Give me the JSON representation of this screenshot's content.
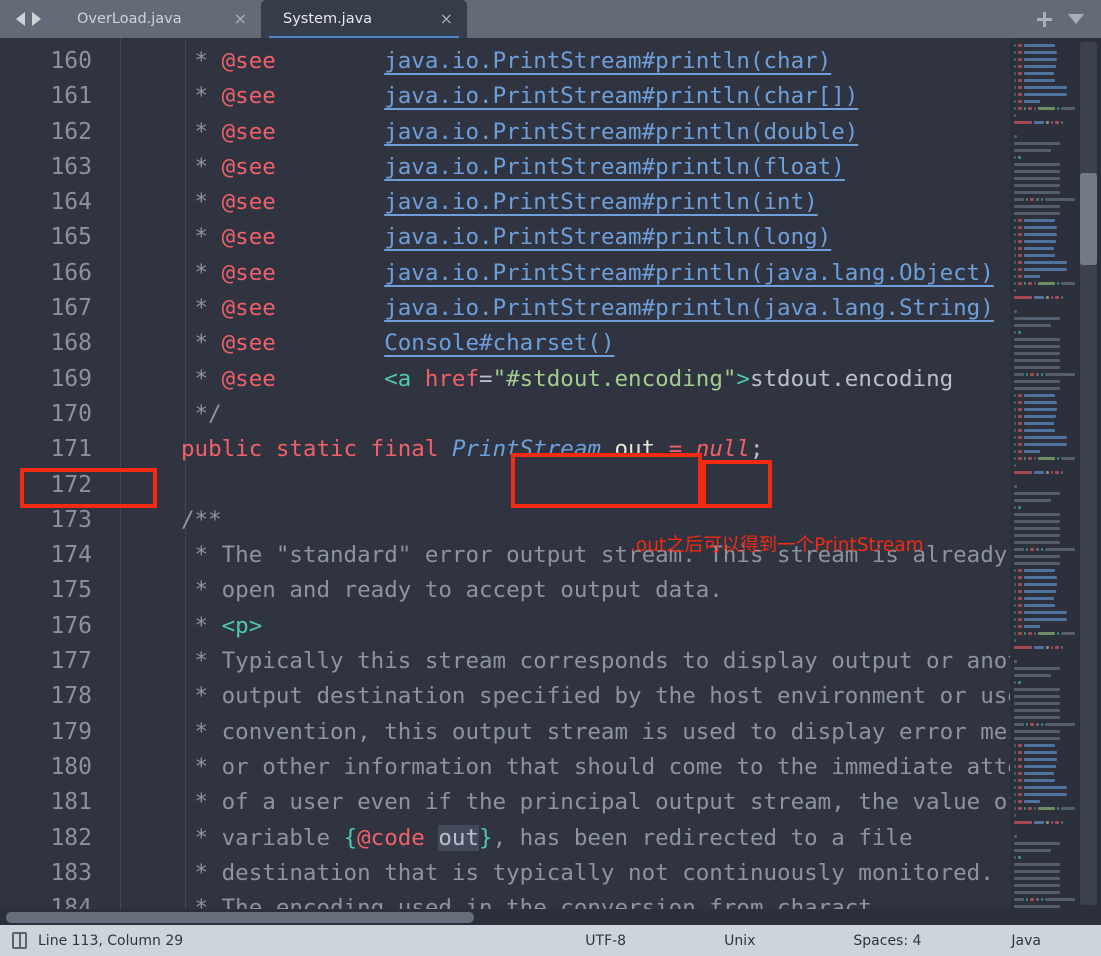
{
  "window": {
    "tabs": [
      {
        "label": "OverLoad.java",
        "active": false,
        "close": "×"
      },
      {
        "label": "System.java",
        "active": true,
        "close": "×"
      }
    ],
    "nav_back_icon": "arrow-left-icon",
    "nav_forward_icon": "arrow-right-icon",
    "new_tab_icon": "plus-icon",
    "tab_menu_icon": "chevron-down-icon"
  },
  "editor": {
    "first_line": 160,
    "line_numbers": [
      160,
      161,
      162,
      163,
      164,
      165,
      166,
      167,
      168,
      169,
      170,
      171,
      172,
      173,
      174,
      175,
      176,
      177,
      178,
      179,
      180,
      181,
      182,
      183,
      184
    ],
    "lines": [
      {
        "n": 160,
        "tokens": [
          {
            "t": " * ",
            "c": "cmt"
          },
          {
            "t": "@see",
            "c": "tag"
          },
          {
            "t": "        ",
            "c": "plain"
          },
          {
            "t": "java.io.PrintStream#println(char)",
            "c": "link"
          }
        ]
      },
      {
        "n": 161,
        "tokens": [
          {
            "t": " * ",
            "c": "cmt"
          },
          {
            "t": "@see",
            "c": "tag"
          },
          {
            "t": "        ",
            "c": "plain"
          },
          {
            "t": "java.io.PrintStream#println(char[])",
            "c": "link"
          }
        ]
      },
      {
        "n": 162,
        "tokens": [
          {
            "t": " * ",
            "c": "cmt"
          },
          {
            "t": "@see",
            "c": "tag"
          },
          {
            "t": "        ",
            "c": "plain"
          },
          {
            "t": "java.io.PrintStream#println(double)",
            "c": "link"
          }
        ]
      },
      {
        "n": 163,
        "tokens": [
          {
            "t": " * ",
            "c": "cmt"
          },
          {
            "t": "@see",
            "c": "tag"
          },
          {
            "t": "        ",
            "c": "plain"
          },
          {
            "t": "java.io.PrintStream#println(float)",
            "c": "link"
          }
        ]
      },
      {
        "n": 164,
        "tokens": [
          {
            "t": " * ",
            "c": "cmt"
          },
          {
            "t": "@see",
            "c": "tag"
          },
          {
            "t": "        ",
            "c": "plain"
          },
          {
            "t": "java.io.PrintStream#println(int)",
            "c": "link"
          }
        ]
      },
      {
        "n": 165,
        "tokens": [
          {
            "t": " * ",
            "c": "cmt"
          },
          {
            "t": "@see",
            "c": "tag"
          },
          {
            "t": "        ",
            "c": "plain"
          },
          {
            "t": "java.io.PrintStream#println(long)",
            "c": "link"
          }
        ]
      },
      {
        "n": 166,
        "tokens": [
          {
            "t": " * ",
            "c": "cmt"
          },
          {
            "t": "@see",
            "c": "tag"
          },
          {
            "t": "        ",
            "c": "plain"
          },
          {
            "t": "java.io.PrintStream#println(java.lang.Object)",
            "c": "link"
          }
        ]
      },
      {
        "n": 167,
        "tokens": [
          {
            "t": " * ",
            "c": "cmt"
          },
          {
            "t": "@see",
            "c": "tag"
          },
          {
            "t": "        ",
            "c": "plain"
          },
          {
            "t": "java.io.PrintStream#println(java.lang.String)",
            "c": "link"
          }
        ]
      },
      {
        "n": 168,
        "tokens": [
          {
            "t": " * ",
            "c": "cmt"
          },
          {
            "t": "@see",
            "c": "tag"
          },
          {
            "t": "        ",
            "c": "plain"
          },
          {
            "t": "Console#charset()",
            "c": "link"
          }
        ]
      },
      {
        "n": 169,
        "tokens": [
          {
            "t": " * ",
            "c": "cmt"
          },
          {
            "t": "@see",
            "c": "tag"
          },
          {
            "t": "        ",
            "c": "plain"
          },
          {
            "t": "<a",
            "c": "brk"
          },
          {
            "t": " ",
            "c": "plain"
          },
          {
            "t": "href",
            "c": "attr"
          },
          {
            "t": "=",
            "c": "plain"
          },
          {
            "t": "\"#stdout.encoding\"",
            "c": "str"
          },
          {
            "t": ">",
            "c": "brk"
          },
          {
            "t": "stdout.encoding",
            "c": "plain"
          }
        ]
      },
      {
        "n": 170,
        "tokens": [
          {
            "t": " */",
            "c": "cmt"
          }
        ]
      },
      {
        "n": 171,
        "tokens": [
          {
            "t": "public static final",
            "c": "kw"
          },
          {
            "t": " ",
            "c": "plain"
          },
          {
            "t": "PrintStream",
            "c": "type"
          },
          {
            "t": " ",
            "c": "plain"
          },
          {
            "t": "out",
            "c": "ident"
          },
          {
            "t": " ",
            "c": "plain"
          },
          {
            "t": "=",
            "c": "kw"
          },
          {
            "t": " ",
            "c": "plain"
          },
          {
            "t": "null",
            "c": "null"
          },
          {
            "t": ";",
            "c": "punct"
          }
        ]
      },
      {
        "n": 172,
        "tokens": [
          {
            "t": "",
            "c": "plain"
          }
        ]
      },
      {
        "n": 173,
        "tokens": [
          {
            "t": "/**",
            "c": "cmt"
          }
        ]
      },
      {
        "n": 174,
        "tokens": [
          {
            "t": " * The \"standard\" error output stream. This stream is already",
            "c": "cmt"
          }
        ]
      },
      {
        "n": 175,
        "tokens": [
          {
            "t": " * open and ready to accept output data.",
            "c": "cmt"
          }
        ]
      },
      {
        "n": 176,
        "tokens": [
          {
            "t": " * ",
            "c": "cmt"
          },
          {
            "t": "<p>",
            "c": "brk"
          }
        ]
      },
      {
        "n": 177,
        "tokens": [
          {
            "t": " * Typically this stream corresponds to display output or anot",
            "c": "cmt"
          }
        ]
      },
      {
        "n": 178,
        "tokens": [
          {
            "t": " * output destination specified by the host environment or use",
            "c": "cmt"
          }
        ]
      },
      {
        "n": 179,
        "tokens": [
          {
            "t": " * convention, this output stream is used to display error mes",
            "c": "cmt"
          }
        ]
      },
      {
        "n": 180,
        "tokens": [
          {
            "t": " * or other information that should come to the immediate atte",
            "c": "cmt"
          }
        ]
      },
      {
        "n": 181,
        "tokens": [
          {
            "t": " * of a user even if the principal output stream, the value of",
            "c": "cmt"
          }
        ]
      },
      {
        "n": 182,
        "tokens": [
          {
            "t": " * variable ",
            "c": "cmt"
          },
          {
            "t": "{",
            "c": "brk"
          },
          {
            "t": "@code",
            "c": "tag"
          },
          {
            "t": " ",
            "c": "cmt"
          },
          {
            "t": "out",
            "c": "codehl"
          },
          {
            "t": "}",
            "c": "brk"
          },
          {
            "t": ", has been redirected to a file",
            "c": "cmt"
          }
        ]
      },
      {
        "n": 183,
        "tokens": [
          {
            "t": " * destination that is typically not continuously monitored.",
            "c": "cmt"
          }
        ]
      },
      {
        "n": 184,
        "tokens": [
          {
            "t": " * The encoding used in the conversion from charact",
            "c": "cmt"
          }
        ]
      }
    ]
  },
  "annotations": {
    "line_number_box": "171",
    "type_box_target": "PrintStream",
    "identifier_box_target": "out",
    "note": ".out之后可以得到一个PrintStream",
    "color": "#f22b12"
  },
  "statusbar": {
    "cursor": "Line 113, Column 29",
    "encoding": "UTF-8",
    "line_ending": "Unix",
    "indent": "Spaces: 4",
    "language": "Java",
    "book_icon": "book-icon"
  },
  "minimap": {
    "name": "code-minimap",
    "scroll_thumb": "minimap-scroll-thumb"
  },
  "scrollbars": {
    "horizontal": "horizontal-scrollbar"
  },
  "theme": {
    "editor_bg": "#2f3440",
    "gutter_fg": "#8b929d",
    "tab_bar_bg": "#646b78",
    "active_tab_bg": "#363c4a",
    "accent_blue": "#4f86c6",
    "status_bg": "#ced4dc",
    "keyword": "#f0606a",
    "link": "#6f9fd8",
    "string": "#a3cc8f",
    "comment": "#8d949f"
  }
}
